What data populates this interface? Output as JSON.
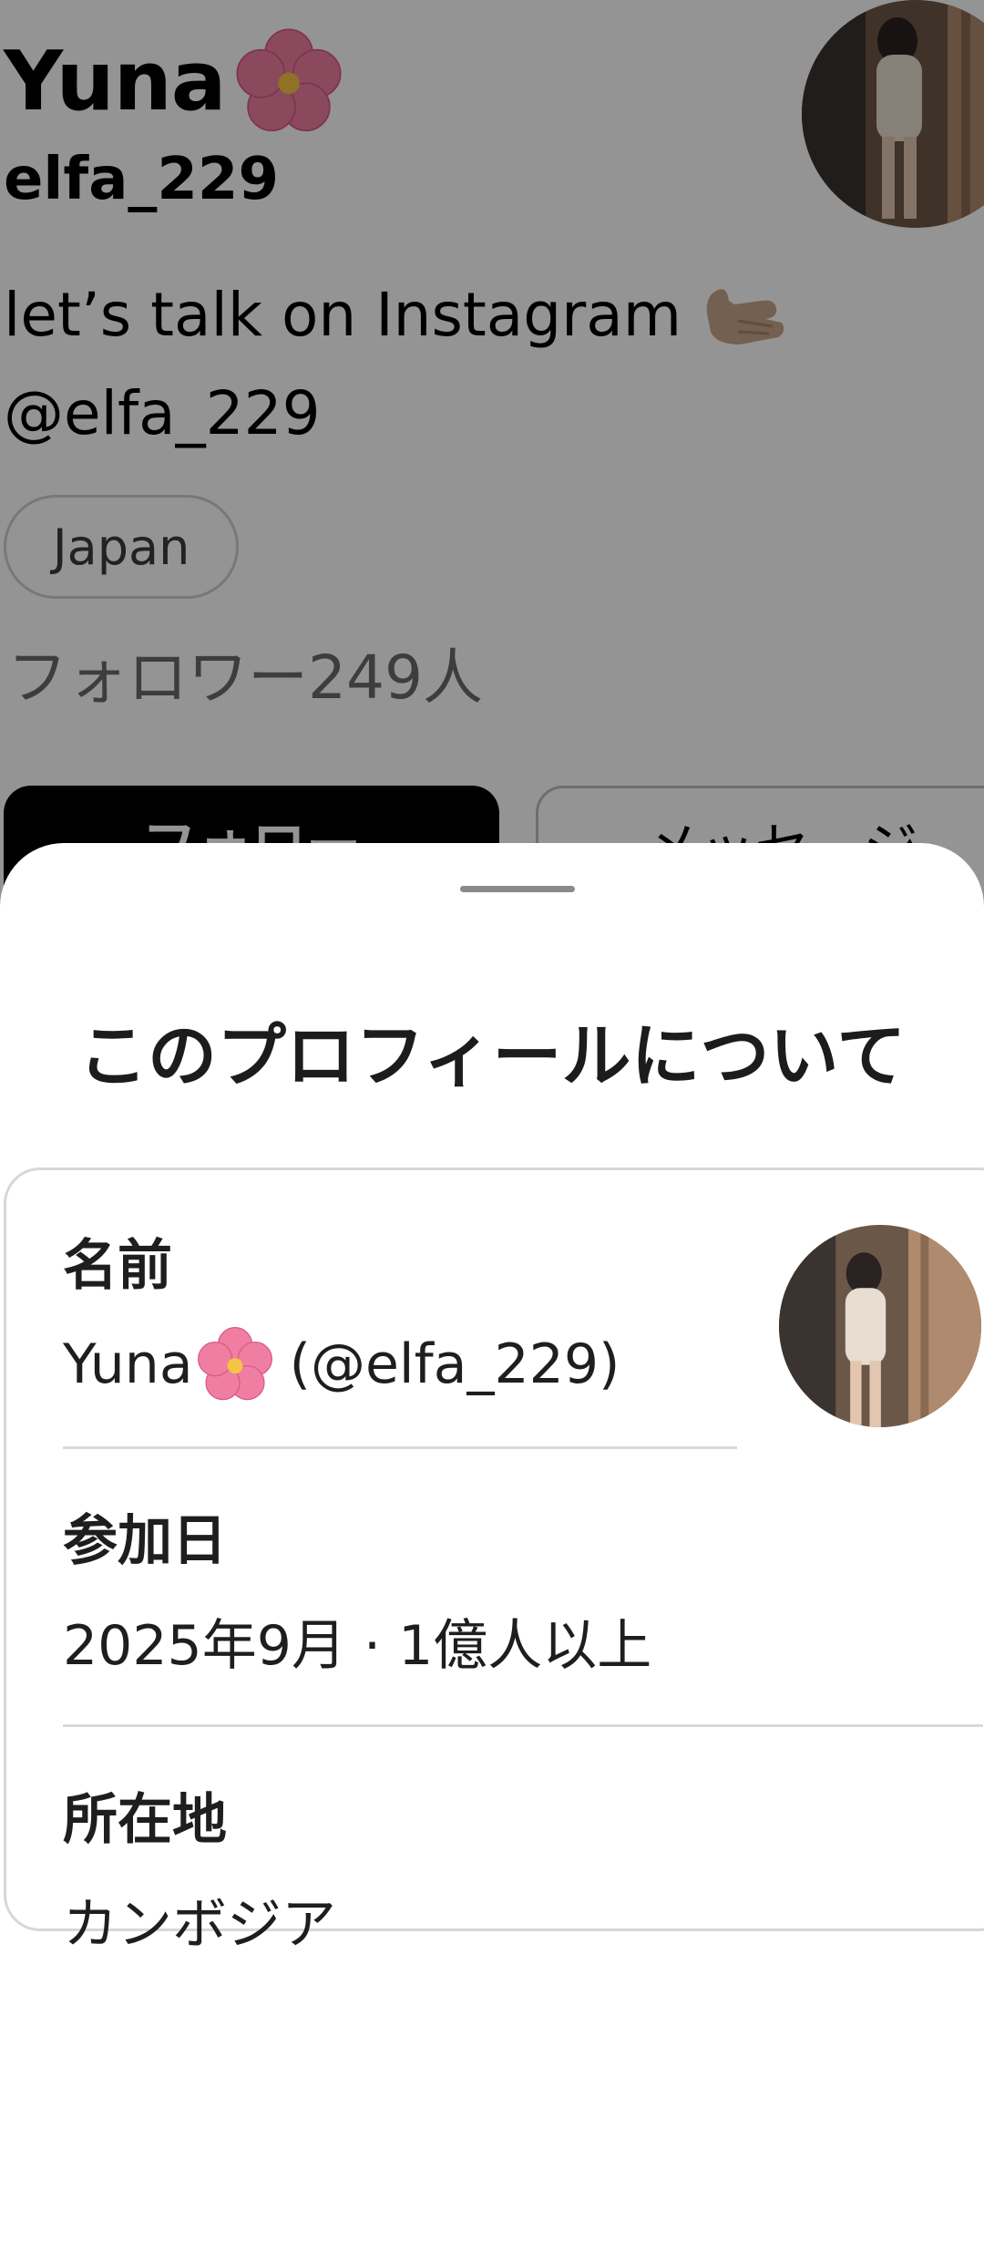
{
  "profile": {
    "display_name": "Yuna",
    "username": "elfa_229",
    "bio_line1": "let’s talk on Instagram",
    "bio_line2": "@elfa_229",
    "location_chip": "Japan",
    "followers": "フォロワー249人",
    "follow_button": "フォロー",
    "message_button": "メッセージ"
  },
  "sheet": {
    "title": "このプロフィールについて",
    "name_label": "名前",
    "name_value": "Yuna",
    "name_handle": "(@elfa_229)",
    "joined_label": "参加日",
    "joined_value": "2025年9月 · 1億人以上",
    "location_label": "所在地",
    "location_value": "カンボジア"
  },
  "colors": {
    "flower": "#f07ea2",
    "scrim": "rgba(0,0,0,0.42)"
  }
}
